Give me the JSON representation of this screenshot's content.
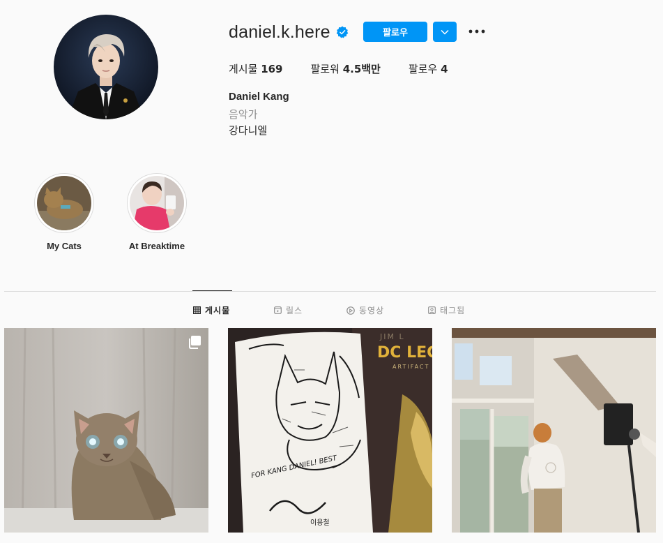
{
  "profile": {
    "username": "daniel.k.here",
    "verified": true,
    "follow_label": "팔로우",
    "stats": {
      "posts_label": "게시물",
      "posts_count": "169",
      "followers_label": "팔로워",
      "followers_count": "4.5백만",
      "following_label": "팔로우",
      "following_count": "4"
    },
    "full_name": "Daniel Kang",
    "category": "음악가",
    "bio": "강다니엘"
  },
  "highlights": [
    {
      "label": "My Cats"
    },
    {
      "label": "At Breaktime"
    }
  ],
  "tabs": [
    {
      "label": "게시물",
      "active": true
    },
    {
      "label": "릴스",
      "active": false
    },
    {
      "label": "동영상",
      "active": false
    },
    {
      "label": "태그됨",
      "active": false
    }
  ],
  "posts": [
    {
      "icon": "cat-photo",
      "multi": true
    },
    {
      "icon": "batman-sketch-photo",
      "multi": false,
      "text": "FOR KANG DANIEL! BEST"
    },
    {
      "icon": "photographer-photo",
      "multi": false
    }
  ],
  "colors": {
    "accent": "#0095f6",
    "text": "#262626",
    "secondary": "#8e8e8e",
    "background": "#fafafa"
  }
}
